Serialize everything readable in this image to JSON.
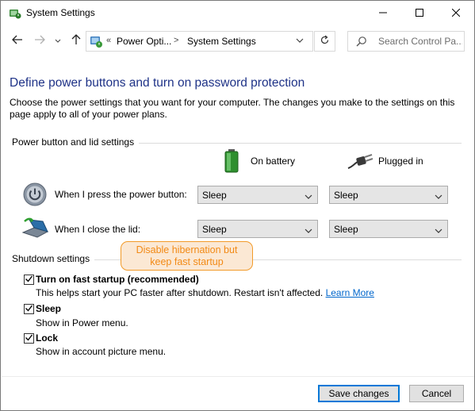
{
  "window": {
    "title": "System Settings",
    "icons": {
      "app": "power-options-icon",
      "minimize": "minimize-icon",
      "maximize": "maximize-icon",
      "close": "close-icon"
    }
  },
  "nav": {
    "back_icon": "back-arrow-icon",
    "forward_icon": "forward-arrow-icon",
    "history_icon": "chevron-down-icon",
    "up_icon": "up-arrow-icon",
    "breadcrumb_prefix": "«",
    "breadcrumbs": [
      "Power Opti...",
      "System Settings"
    ],
    "breadcrumb_separator": ">",
    "refresh_icon": "refresh-icon",
    "search_placeholder": "Search Control Pa..."
  },
  "page": {
    "heading": "Define power buttons and turn on password protection",
    "description": "Choose the power settings that you want for your computer. The changes you make to the settings on this page apply to all of your power plans."
  },
  "power_section": {
    "title": "Power button and lid settings",
    "columns": [
      {
        "label": "On battery",
        "icon": "battery-icon"
      },
      {
        "label": "Plugged in",
        "icon": "power-plug-icon"
      }
    ],
    "rows": [
      {
        "label": "When I press the power button:",
        "icon": "power-button-icon",
        "on_battery": "Sleep",
        "plugged_in": "Sleep"
      },
      {
        "label": "When I close the lid:",
        "icon": "laptop-lid-icon",
        "on_battery": "Sleep",
        "plugged_in": "Sleep"
      }
    ]
  },
  "callout": {
    "line1": "Disable hibernation but",
    "line2": "keep fast startup"
  },
  "shutdown_section": {
    "title": "Shutdown settings",
    "items": [
      {
        "label": "Turn on fast startup (recommended)",
        "checked": true,
        "description": "This helps start your PC faster after shutdown. Restart isn't affected.",
        "link": "Learn More"
      },
      {
        "label": "Sleep",
        "checked": true,
        "description": "Show in Power menu."
      },
      {
        "label": "Lock",
        "checked": true,
        "description": "Show in account picture menu."
      }
    ]
  },
  "buttons": {
    "save": "Save changes",
    "cancel": "Cancel"
  },
  "colors": {
    "heading": "#1e3287",
    "link": "#0066cc",
    "callout_border": "#f29b2a",
    "callout_fill": "#fbe8d4",
    "callout_text": "#f28a16",
    "primary_button_border": "#0078d7"
  }
}
